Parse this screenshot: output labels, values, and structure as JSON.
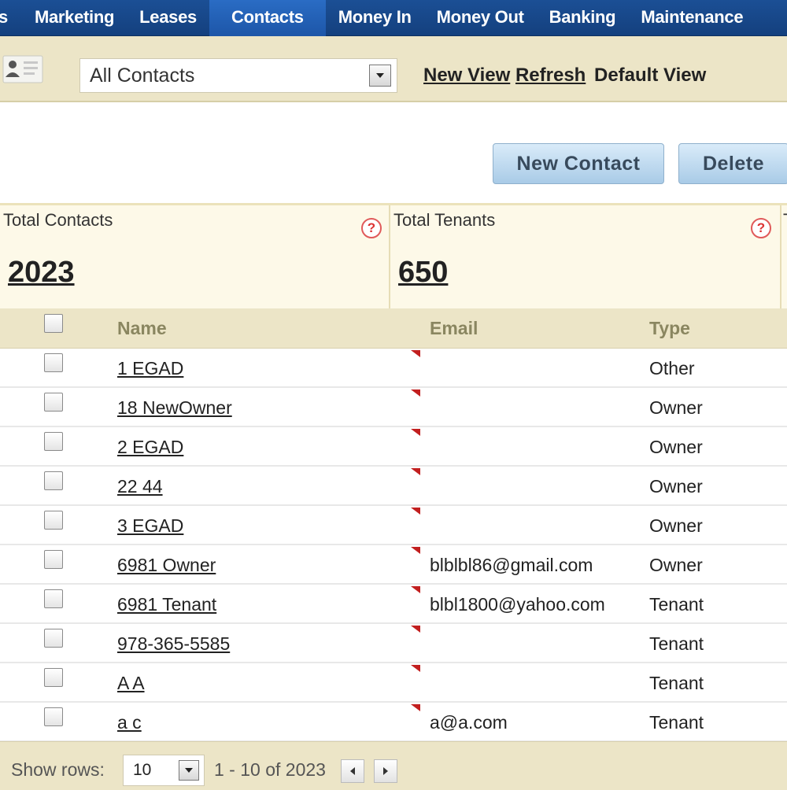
{
  "nav": {
    "items": [
      {
        "label": "s",
        "active": false
      },
      {
        "label": "Marketing",
        "active": false
      },
      {
        "label": "Leases",
        "active": false
      },
      {
        "label": "Contacts",
        "active": true
      },
      {
        "label": "Money In",
        "active": false
      },
      {
        "label": "Money Out",
        "active": false
      },
      {
        "label": "Banking",
        "active": false
      },
      {
        "label": "Maintenance",
        "active": false
      }
    ]
  },
  "toolbar": {
    "view_select": "All Contacts",
    "new_view": "New View",
    "refresh": "Refresh",
    "default_view": "Default View"
  },
  "actions": {
    "new_contact": "New Contact",
    "delete": "Delete"
  },
  "summary": {
    "total_contacts_label": "Total Contacts",
    "total_contacts_value": "2023",
    "total_tenants_label": "Total Tenants",
    "total_tenants_value": "650",
    "next_panel_label": "T",
    "help_glyph": "?"
  },
  "table": {
    "headers": {
      "name": "Name",
      "email": "Email",
      "type": "Type"
    },
    "rows": [
      {
        "name": "1 EGAD",
        "email": "",
        "type": "Other"
      },
      {
        "name": "18 NewOwner",
        "email": "",
        "type": "Owner"
      },
      {
        "name": "2 EGAD",
        "email": "",
        "type": "Owner"
      },
      {
        "name": "22 44",
        "email": "",
        "type": "Owner"
      },
      {
        "name": "3 EGAD",
        "email": "",
        "type": "Owner"
      },
      {
        "name": "6981 Owner",
        "email": "blblbl86@gmail.com",
        "type": "Owner"
      },
      {
        "name": "6981 Tenant",
        "email": "blbl1800@yahoo.com",
        "type": "Tenant"
      },
      {
        "name": "978-365-5585",
        "email": "",
        "type": "Tenant"
      },
      {
        "name": "A A",
        "email": "",
        "type": "Tenant"
      },
      {
        "name": "a c",
        "email": "a@a.com",
        "type": "Tenant"
      }
    ]
  },
  "footer": {
    "show_rows_label": "Show rows:",
    "rows_value": "10",
    "range": "1 - 10 of 2023"
  },
  "colors": {
    "nav_bg": "#1b4f95",
    "nav_active": "#2a6cc4",
    "toolbar_bg": "#ece5c7",
    "summary_bg": "#fdf9e8",
    "header_text": "#8a8660"
  }
}
